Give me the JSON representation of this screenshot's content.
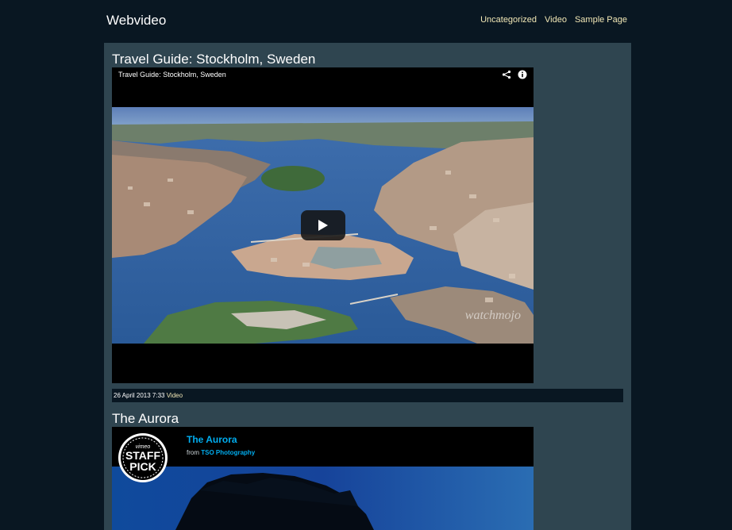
{
  "site": {
    "title": "Webvideo",
    "nav": [
      "Uncategorized",
      "Video",
      "Sample Page"
    ]
  },
  "colors": {
    "page_bg": "#091722",
    "content_bg": "#2f4550",
    "nav_link": "#f1e7b5",
    "vimeo_blue": "#00adef"
  },
  "posts": [
    {
      "title": "Travel Guide: Stockholm, Sweden",
      "video": {
        "overlay_title": "Travel Guide: Stockholm, Sweden",
        "icons": [
          "share-icon",
          "info-icon",
          "play-icon"
        ],
        "watermark": "watchmojo"
      },
      "meta": {
        "date": "26 April 2013 7:33",
        "category": "Video"
      }
    },
    {
      "title": "The Aurora",
      "video": {
        "title": "The Aurora",
        "from_label": "from",
        "author": "TSO Photography",
        "badge_top": "vimeo",
        "badge_line1": "STAFF",
        "badge_line2": "PICK"
      }
    }
  ]
}
